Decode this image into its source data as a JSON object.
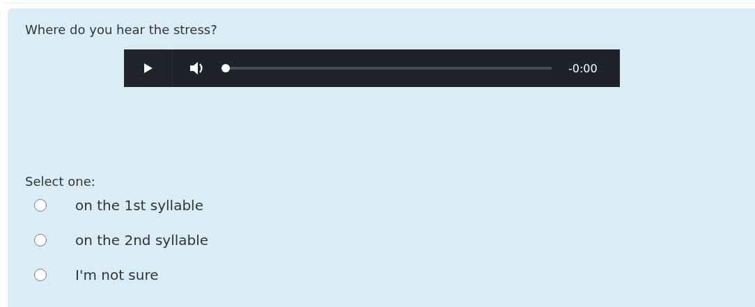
{
  "question": {
    "text": "Where do you hear the stress?"
  },
  "player": {
    "level": 0,
    "time": "-0:00"
  },
  "prompt": "Select one:",
  "options": [
    {
      "label": "on the 1st syllable",
      "selected": false
    },
    {
      "label": "on the 2nd syllable",
      "selected": false
    },
    {
      "label": "I'm not sure",
      "selected": false
    }
  ]
}
